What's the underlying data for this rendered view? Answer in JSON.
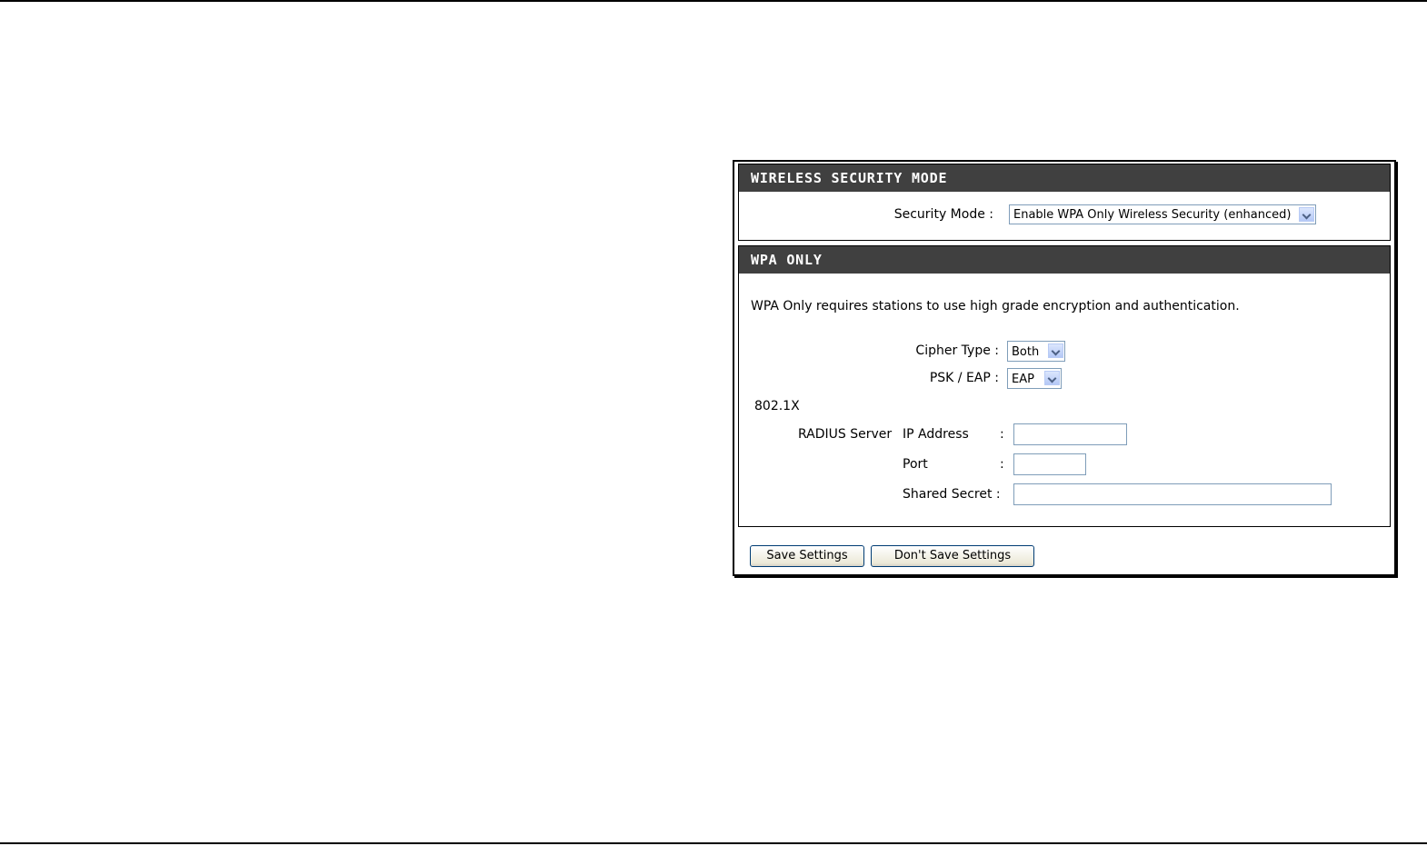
{
  "wireless_security_mode": {
    "header": "WIRELESS SECURITY MODE",
    "security_mode_label": "Security Mode :",
    "security_mode_value": "Enable WPA Only Wireless Security (enhanced)"
  },
  "wpa_only": {
    "header": "WPA ONLY",
    "description": "WPA Only requires stations to use high grade encryption and authentication.",
    "cipher_type_label": "Cipher Type :",
    "cipher_type_value": "Both",
    "psk_eap_label": "PSK / EAP :",
    "psk_eap_value": "EAP",
    "section_8021x": "802.1X",
    "radius_server_label": "RADIUS Server",
    "ip_address_label": "IP Address",
    "port_label": "Port",
    "shared_secret_label": "Shared Secret :",
    "colon": ":",
    "ip_address_value": "",
    "port_value": "",
    "shared_secret_value": ""
  },
  "buttons": {
    "save": "Save Settings",
    "dont_save": "Don't Save Settings"
  },
  "colors": {
    "header_bg": "#404040",
    "header_text": "#ffffff"
  }
}
